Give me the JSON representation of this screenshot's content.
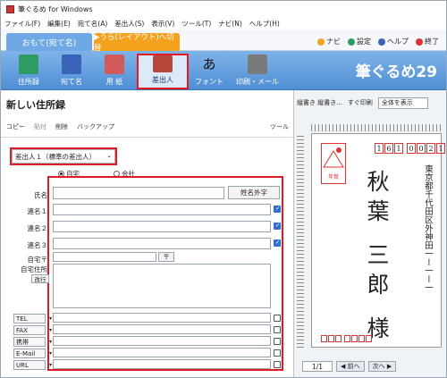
{
  "window": {
    "title": "筆ぐるめ for Windows"
  },
  "menu": [
    "ファイル(F)",
    "編集(E)",
    "宛て名(A)",
    "差出人(S)",
    "表示(V)",
    "ツール(T)",
    "ナビ(N)",
    "ヘルプ(H)"
  ],
  "modes": {
    "front": "おもて(宛て名)",
    "back": "▶うら(レイアウト)へ切替"
  },
  "links": {
    "navi": "ナビ",
    "settings": "設定",
    "help": "ヘルプ",
    "exit": "終了"
  },
  "ribbon": [
    {
      "label": "住所録",
      "color": "#2e9b63"
    },
    {
      "label": "宛て名",
      "color": "#3a64b8"
    },
    {
      "label": "用 紙",
      "color": "#d35a5a"
    },
    {
      "label": "差出人",
      "color": "#b5483a"
    },
    {
      "label": "フォント",
      "color": "#1a1a1a"
    },
    {
      "label": "印刷・メール",
      "color": "#7a7a7a"
    }
  ],
  "brand": "筆ぐるめ29",
  "left": {
    "title": "新しい住所録",
    "toolbar": {
      "copy": "コピー",
      "paste": "貼付",
      "delete": "削除",
      "backup": "バックアップ",
      "tools": "ツール"
    },
    "sender_select": "差出人１（標準の差出人）",
    "radios": {
      "home": "自宅",
      "company": "会社"
    },
    "fields": {
      "name": "氏名",
      "joint1": "連名１",
      "joint2": "連名２",
      "joint3": "連名３",
      "zip": "自宅〒",
      "zip_btn": "〒",
      "address": "自宅住所",
      "newline_btn": "改行",
      "external_btn": "姓名外字"
    },
    "contacts": [
      "TEL",
      "FAX",
      "携帯",
      "E-Mail",
      "URL"
    ]
  },
  "right": {
    "tool1": "縦書き 縦書き...",
    "tool2": "すぐ印刷",
    "view_select": "全体を表示",
    "postcard": {
      "zip": [
        "1",
        "6",
        "1",
        "0",
        "0",
        "2",
        "1"
      ],
      "address": "東京都千代田区外神田一ー一ー一",
      "name": "秋葉 三郎 様",
      "stamp": "年賀"
    },
    "page": "1/1",
    "prev": "◀ 前へ",
    "next": "次へ ▶"
  },
  "colors": {
    "highlight": "#e01b24",
    "accent": "#4f8fd4",
    "orange": "#f3a21d"
  }
}
